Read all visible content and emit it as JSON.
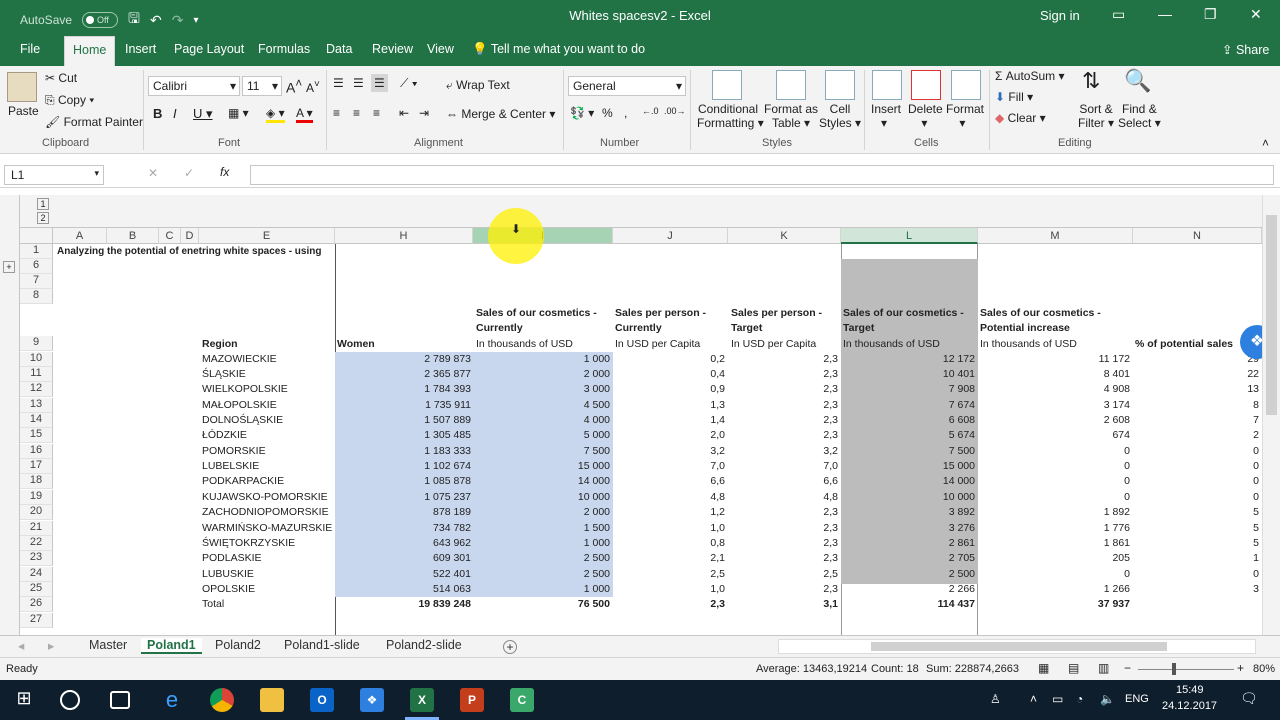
{
  "window": {
    "title": "Whites spacesv2 - Excel",
    "autosave_label": "AutoSave",
    "autosave_state": "Off",
    "signin": "Sign in"
  },
  "menu": {
    "items": [
      "File",
      "Home",
      "Insert",
      "Page Layout",
      "Formulas",
      "Data",
      "Review",
      "View"
    ],
    "tell_me": "Tell me what you want to do",
    "share": "Share"
  },
  "ribbon": {
    "clipboard": {
      "paste": "Paste",
      "cut": "Cut",
      "copy": "Copy",
      "format_painter": "Format Painter",
      "label": "Clipboard"
    },
    "font": {
      "name": "Calibri",
      "size": "11",
      "label": "Font"
    },
    "alignment": {
      "wrap": "Wrap Text",
      "merge": "Merge & Center",
      "label": "Alignment"
    },
    "number": {
      "format": "General",
      "label": "Number"
    },
    "styles": {
      "cond": "Conditional",
      "cond2": "Formatting",
      "fmt_table": "Format as",
      "fmt_table2": "Table",
      "cell_styles": "Cell",
      "cell_styles2": "Styles",
      "label": "Styles"
    },
    "cells": {
      "insert": "Insert",
      "delete": "Delete",
      "format": "Format",
      "label": "Cells"
    },
    "editing": {
      "autosum": "AutoSum",
      "fill": "Fill",
      "clear": "Clear",
      "sort": "Sort &",
      "sort2": "Filter",
      "find": "Find &",
      "find2": "Select",
      "label": "Editing"
    }
  },
  "formula_bar": {
    "name_box": "L1",
    "fx": "fx",
    "value": ""
  },
  "columns": [
    {
      "name": "A"
    },
    {
      "name": "B"
    },
    {
      "name": "C"
    },
    {
      "name": "D"
    },
    {
      "name": "E"
    },
    {
      "name": "H"
    },
    {
      "name": "I"
    },
    {
      "name": "J"
    },
    {
      "name": "K"
    },
    {
      "name": "L"
    },
    {
      "name": "M"
    },
    {
      "name": "N"
    }
  ],
  "sheet_title": "Analyzing the potential of enetring white spaces - using",
  "headers": {
    "region": "Region",
    "women": "Women",
    "i1": "Sales of our cosmetics -",
    "i2": "Currently",
    "i3": "In thousands of USD",
    "j1": "Sales per person -",
    "j2": "Currently",
    "j3": "In USD per Capita",
    "k1": "Sales per person -",
    "k2": "Target",
    "k3": "In USD per Capita",
    "l1": "Sales of our cosmetics -",
    "l2": "Target",
    "l3": "In thousands of USD",
    "m1": "Sales of our cosmetics -",
    "m2": "Potential increase",
    "m3": "In thousands of USD",
    "n1": "% of potential sales"
  },
  "row_numbers": [
    "1",
    "6",
    "7",
    "8",
    "9",
    "10",
    "11",
    "12",
    "13",
    "14",
    "15",
    "16",
    "17",
    "18",
    "19",
    "20",
    "21",
    "22",
    "23",
    "24",
    "25",
    "26",
    "27"
  ],
  "rows": [
    {
      "region": "MAZOWIECKIE",
      "women": "2 789 873",
      "sales": "1 000",
      "pp": "0,2",
      "target_pp": "2,3",
      "target": "12 172",
      "inc": "11 172",
      "pct": "29"
    },
    {
      "region": "ŚLĄSKIE",
      "women": "2 365 877",
      "sales": "2 000",
      "pp": "0,4",
      "target_pp": "2,3",
      "target": "10 401",
      "inc": "8 401",
      "pct": "22"
    },
    {
      "region": "WIELKOPOLSKIE",
      "women": "1 784 393",
      "sales": "3 000",
      "pp": "0,9",
      "target_pp": "2,3",
      "target": "7 908",
      "inc": "4 908",
      "pct": "13"
    },
    {
      "region": "MAŁOPOLSKIE",
      "women": "1 735 911",
      "sales": "4 500",
      "pp": "1,3",
      "target_pp": "2,3",
      "target": "7 674",
      "inc": "3 174",
      "pct": "8"
    },
    {
      "region": "DOLNOŚLĄSKIE",
      "women": "1 507 889",
      "sales": "4 000",
      "pp": "1,4",
      "target_pp": "2,3",
      "target": "6 608",
      "inc": "2 608",
      "pct": "7"
    },
    {
      "region": "ŁÓDZKIE",
      "women": "1 305 485",
      "sales": "5 000",
      "pp": "2,0",
      "target_pp": "2,3",
      "target": "5 674",
      "inc": "674",
      "pct": "2"
    },
    {
      "region": "POMORSKIE",
      "women": "1 183 333",
      "sales": "7 500",
      "pp": "3,2",
      "target_pp": "3,2",
      "target": "7 500",
      "inc": "0",
      "pct": "0"
    },
    {
      "region": "LUBELSKIE",
      "women": "1 102 674",
      "sales": "15 000",
      "pp": "7,0",
      "target_pp": "7,0",
      "target": "15 000",
      "inc": "0",
      "pct": "0"
    },
    {
      "region": "PODKARPACKIE",
      "women": "1 085 878",
      "sales": "14 000",
      "pp": "6,6",
      "target_pp": "6,6",
      "target": "14 000",
      "inc": "0",
      "pct": "0"
    },
    {
      "region": "KUJAWSKO-POMORSKIE",
      "women": "1 075 237",
      "sales": "10 000",
      "pp": "4,8",
      "target_pp": "4,8",
      "target": "10 000",
      "inc": "0",
      "pct": "0"
    },
    {
      "region": "ZACHODNIOPOMORSKIE",
      "women": "878 189",
      "sales": "2 000",
      "pp": "1,2",
      "target_pp": "2,3",
      "target": "3 892",
      "inc": "1 892",
      "pct": "5"
    },
    {
      "region": "WARMIŃSKO-MAZURSKIE",
      "women": "734 782",
      "sales": "1 500",
      "pp": "1,0",
      "target_pp": "2,3",
      "target": "3 276",
      "inc": "1 776",
      "pct": "5"
    },
    {
      "region": "ŚWIĘTOKRZYSKIE",
      "women": "643 962",
      "sales": "1 000",
      "pp": "0,8",
      "target_pp": "2,3",
      "target": "2 861",
      "inc": "1 861",
      "pct": "5"
    },
    {
      "region": "PODLASKIE",
      "women": "609 301",
      "sales": "2 500",
      "pp": "2,1",
      "target_pp": "2,3",
      "target": "2 705",
      "inc": "205",
      "pct": "1"
    },
    {
      "region": "LUBUSKIE",
      "women": "522 401",
      "sales": "2 500",
      "pp": "2,5",
      "target_pp": "2,5",
      "target": "2 500",
      "inc": "0",
      "pct": "0"
    },
    {
      "region": "OPOLSKIE",
      "women": "514 063",
      "sales": "1 000",
      "pp": "1,0",
      "target_pp": "2,3",
      "target": "2 266",
      "inc": "1 266",
      "pct": "3"
    }
  ],
  "total": {
    "region": "Total",
    "women": "19 839 248",
    "sales": "76 500",
    "pp": "2,3",
    "target_pp": "3,1",
    "target": "114 437",
    "inc": "37 937"
  },
  "tabs": [
    "Master",
    "Poland1",
    "Poland2",
    "Poland1-slide",
    "Poland2-slide"
  ],
  "active_tab": "Poland1",
  "status": {
    "ready": "Ready",
    "average": "Average: 13463,19214",
    "count": "Count: 18",
    "sum": "Sum: 228874,2663",
    "zoom": "80%"
  },
  "taskbar": {
    "lang": "ENG",
    "time": "15:49",
    "date": "24.12.2017"
  }
}
